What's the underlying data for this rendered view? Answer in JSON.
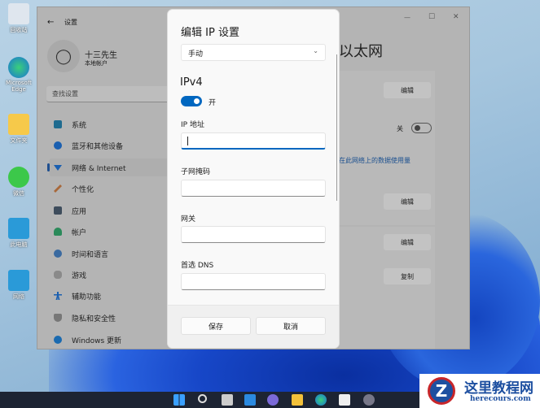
{
  "desktop": {
    "icons": [
      "回收站",
      "Microsoft Edge",
      "文件夹",
      "微信",
      "此电脑",
      "网络"
    ]
  },
  "settings": {
    "title": "设置",
    "user": {
      "name": "十三先生",
      "account": "本地帐户"
    },
    "search_placeholder": "查找设置",
    "nav": [
      "系统",
      "蓝牙和其他设备",
      "网络 & Internet",
      "个性化",
      "应用",
      "帐户",
      "时间和语言",
      "游戏",
      "辅助功能",
      "隐私和安全性",
      "Windows 更新"
    ],
    "selected_nav": 2,
    "page_title": "以太网",
    "buttons": {
      "edit1": "编辑",
      "edit2": "编辑",
      "edit3": "编辑",
      "copy": "复制"
    },
    "metered_toggle": "关",
    "data_usage_link": "在此网络上的数据使用量",
    "window_controls": {
      "minimize": "—",
      "maximize": "☐",
      "close": "✕"
    }
  },
  "dialog": {
    "title": "编辑 IP 设置",
    "mode": "手动",
    "section": "IPv4",
    "ipv4_toggle": "开",
    "fields": [
      {
        "label": "IP 地址",
        "value": ""
      },
      {
        "label": "子网掩码",
        "value": ""
      },
      {
        "label": "网关",
        "value": ""
      },
      {
        "label": "首选 DNS",
        "value": ""
      }
    ],
    "save": "保存",
    "cancel": "取消"
  },
  "watermark": {
    "title": "这里教程网",
    "url": "herecours.com"
  },
  "colors": {
    "accent": "#0067c0",
    "link": "#1a4f8f"
  }
}
